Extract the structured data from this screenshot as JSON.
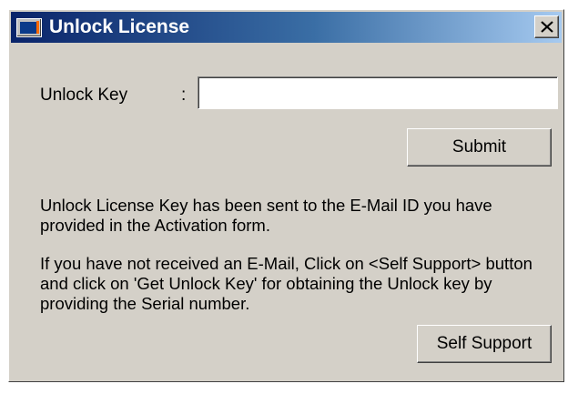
{
  "window": {
    "title": "Unlock License",
    "title_icon": "license-app-icon",
    "close_icon": "close-icon",
    "colors": {
      "titlebar_start": "#0a246a",
      "titlebar_end": "#a6caf0",
      "face": "#d4d0c8"
    }
  },
  "form": {
    "unlock_key_label": "Unlock Key",
    "separator": ":",
    "unlock_key_value": "",
    "submit_label": "Submit"
  },
  "messages": {
    "sent_notice": "Unlock License Key has been sent to the E-Mail ID you have provided in the Activation form.",
    "self_support_hint": "If you have not received an E-Mail, Click on <Self Support> button and click on 'Get Unlock Key' for obtaining the Unlock key by providing the Serial number."
  },
  "actions": {
    "self_support_label": "Self Support"
  }
}
